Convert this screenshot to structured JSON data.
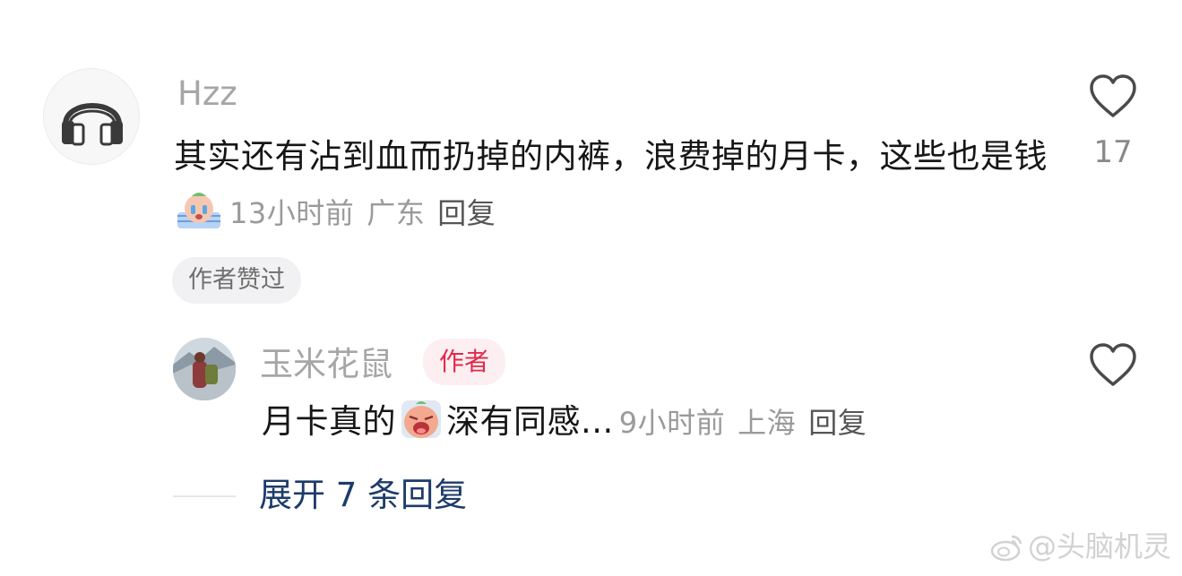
{
  "comment": {
    "username": "Hzz",
    "avatar_icon": "headphones-icon",
    "text_part1": "其实还有沾到血而扔掉的内裤，浪费掉的月卡，这些也是钱",
    "emoji": "crying-emoji",
    "time": "13小时前",
    "location": "广东",
    "reply_label": "回复",
    "liked_badge": "作者赞过",
    "like_count": "17"
  },
  "reply": {
    "username": "玉米花鼠",
    "author_badge": "作者",
    "text_part1": "月卡真的",
    "emoji": "weeping-emoji",
    "text_part2": "深有同感...",
    "time": "9小时前",
    "location": "上海",
    "reply_label": "回复"
  },
  "expand": {
    "label": "展开 7 条回复"
  },
  "watermark": {
    "text": "@头脑机灵"
  },
  "colors": {
    "author_badge_text": "#e1294b",
    "author_badge_bg": "#fdeff1",
    "expand_link": "#1d3b6a"
  }
}
